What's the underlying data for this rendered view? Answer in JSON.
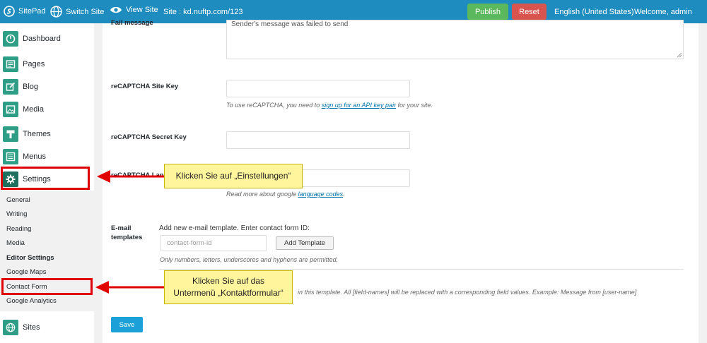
{
  "topbar": {
    "logo": "SitePad",
    "switch_site": "Switch Site",
    "view_site": "View Site",
    "site": "Site : kd.nuftp.com/123",
    "publish": "Publish",
    "reset": "Reset",
    "language": "English (United States)",
    "welcome": "Welcome, admin"
  },
  "sidebar": {
    "items": [
      {
        "label": "Dashboard",
        "icon": "dashboard-icon"
      },
      {
        "label": "Pages",
        "icon": "pages-icon"
      },
      {
        "label": "Blog",
        "icon": "blog-icon"
      },
      {
        "label": "Media",
        "icon": "media-icon"
      },
      {
        "label": "Themes",
        "icon": "themes-icon"
      },
      {
        "label": "Menus",
        "icon": "menus-icon"
      },
      {
        "label": "Settings",
        "icon": "gear-icon"
      }
    ],
    "submenu": [
      "General",
      "Writing",
      "Reading",
      "Media",
      "Editor Settings",
      "Google Maps",
      "Contact Form",
      "Google Analytics"
    ],
    "sites": "Sites"
  },
  "form": {
    "fail_label": "Fail message",
    "fail_value": "Sender's message was failed to send",
    "site_key_label": "reCAPTCHA Site Key",
    "site_key_help_pre": "To use reCAPTCHA, you need to ",
    "site_key_help_link": "sign up for an API key pair",
    "site_key_help_post": " for your site.",
    "secret_key_label": "reCAPTCHA Secret Key",
    "lang_label": "reCAPTCHA Language",
    "lang_help_pre": "Read more about google ",
    "lang_help_link": "language codes",
    "lang_help_post": ".",
    "email_label_1": "E-mail",
    "email_label_2": "templates",
    "email_intro": "Add new e-mail template. Enter contact form ID:",
    "cf_placeholder": "contact-form-id",
    "add_template": "Add Template",
    "email_help": "Only numbers, letters, underscores and hyphens are permitted.",
    "fieldnames_help": "in this template. All [field-names] will be replaced with a corresponding field values. Example: Message from [user-name]",
    "save": "Save"
  },
  "annotations": {
    "callout1": "Klicken Sie auf „Einstellungen“",
    "callout2_line1": "Klicken Sie auf das",
    "callout2_line2": "Untermenü „Kontaktformular“",
    "color": "#e00000"
  }
}
